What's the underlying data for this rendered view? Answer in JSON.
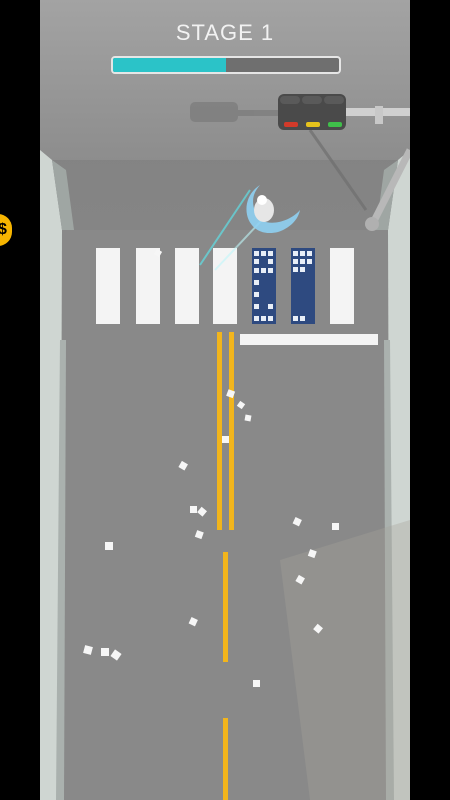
{
  "hud": {
    "stage_label": "STAGE 1",
    "progress_fraction": 0.5,
    "progress_color": "#2bc3c8"
  },
  "scene": {
    "road_color": "#8a8a8a",
    "lane_line_color": "#f2b51c",
    "crosswalk_color": "#f4f4f4",
    "traffic_light": {
      "lights": [
        "#d23a2a",
        "#e6c21c",
        "#3fbf4a"
      ]
    },
    "bus_color": "#2e4a80"
  },
  "side_badge": {
    "icon": "coin-icon",
    "text": "$",
    "color": "#f7b500"
  }
}
